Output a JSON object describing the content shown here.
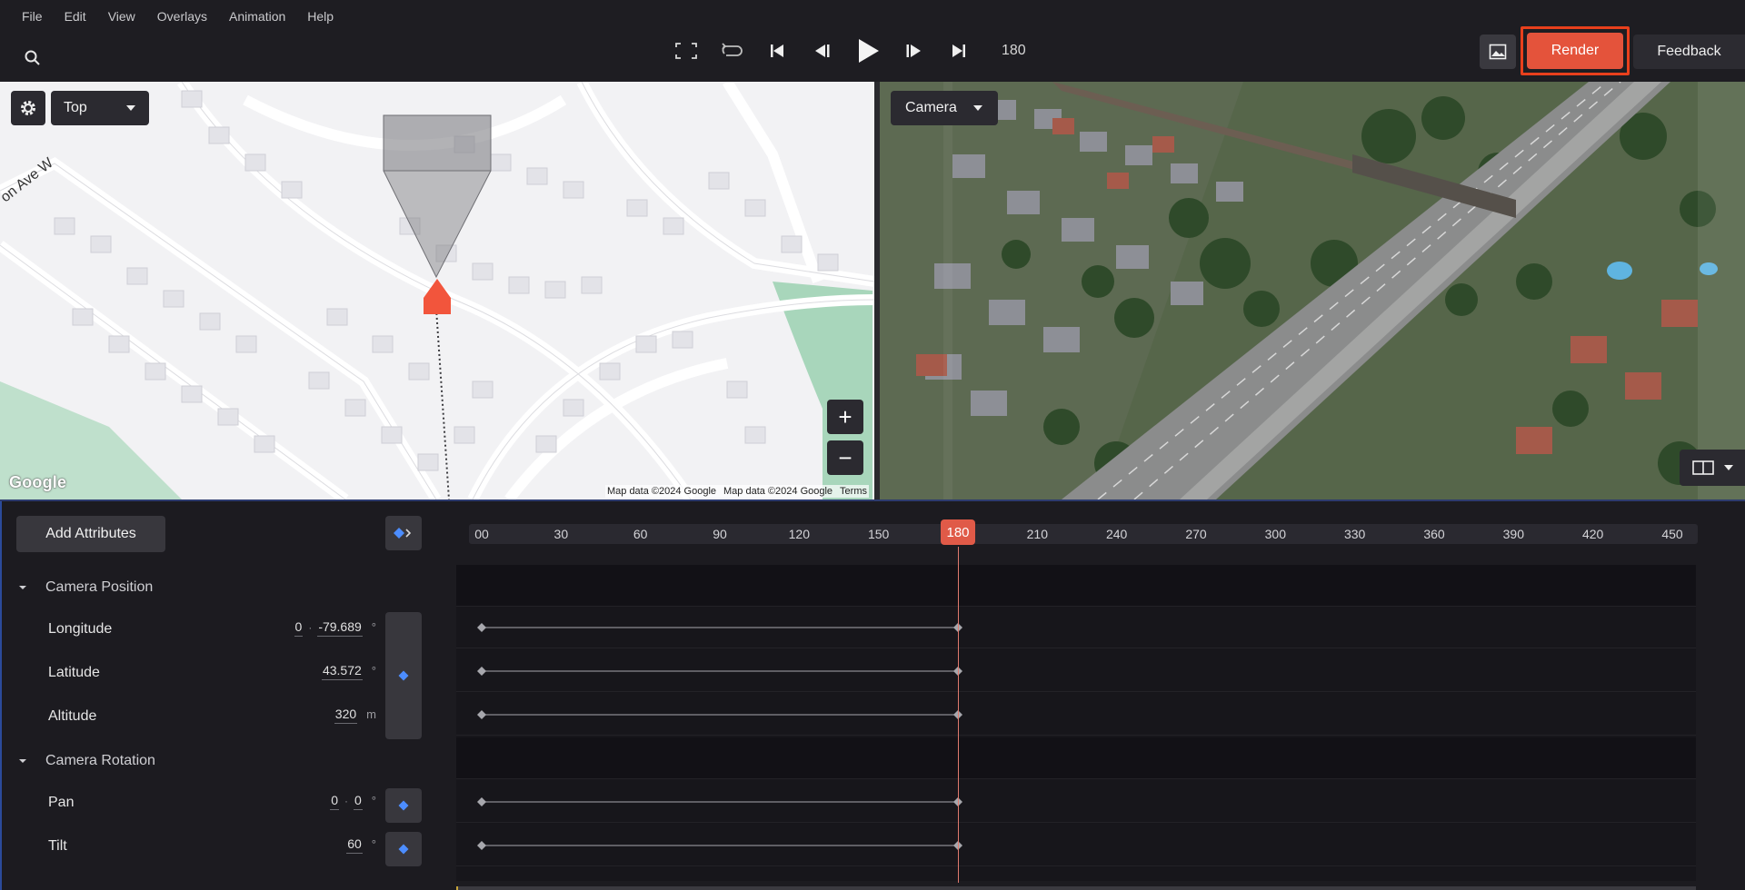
{
  "menu": [
    "File",
    "Edit",
    "View",
    "Overlays",
    "Animation",
    "Help"
  ],
  "transport": {
    "frame": "180"
  },
  "actions": {
    "render": "Render",
    "feedback": "Feedback"
  },
  "map": {
    "view_label": "Top",
    "street_label": "on Ave W",
    "google_logo": "Google",
    "attrib1": "Map data ©2024 Google",
    "attrib2": "Map data ©2024 Google",
    "terms": "Terms",
    "zoom_in": "+",
    "zoom_out": "−"
  },
  "camera_view": {
    "label": "Camera"
  },
  "timeline": {
    "add_attributes": "Add Attributes",
    "ticks": [
      "00",
      "30",
      "60",
      "90",
      "120",
      "150",
      "180",
      "210",
      "240",
      "270",
      "300",
      "330",
      "360",
      "390",
      "420",
      "450"
    ],
    "playhead": "180",
    "playhead_frame": 180,
    "max_frame": 450,
    "groups": [
      {
        "title": "Camera Position"
      },
      {
        "title": "Camera Rotation"
      }
    ],
    "properties": {
      "longitude": {
        "label": "Longitude",
        "v1": "0",
        "v2": "-79.689",
        "unit": "°"
      },
      "latitude": {
        "label": "Latitude",
        "v1": "43.572",
        "unit": "°"
      },
      "altitude": {
        "label": "Altitude",
        "v1": "320",
        "unit": "m"
      },
      "pan": {
        "label": "Pan",
        "v1": "0",
        "v2": "0",
        "unit": "°"
      },
      "tilt": {
        "label": "Tilt",
        "v1": "60",
        "unit": "°"
      }
    },
    "keyframes": [
      0,
      180
    ]
  },
  "colors": {
    "accent": "#e4533b",
    "highlight": "#e8401c",
    "key_diamond": "#4c8dff",
    "panel": "#1c1b20"
  },
  "icons": [
    "search-icon",
    "fullscreen-icon",
    "loop-icon",
    "skip-start-icon",
    "step-back-icon",
    "play-icon",
    "step-forward-icon",
    "skip-end-icon",
    "image-icon",
    "gear-icon",
    "chevron-down-icon",
    "split-view-icon",
    "keyframe-icon",
    "caret-down-icon"
  ]
}
